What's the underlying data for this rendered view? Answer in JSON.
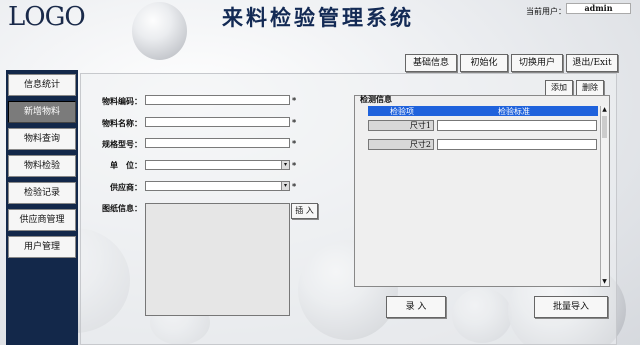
{
  "header": {
    "logo": "LOGO",
    "title": "来料检验管理系统",
    "user_label": "当前用户：",
    "user_value": "admin"
  },
  "top_buttons": [
    "基础信息",
    "初始化",
    "切换用户",
    "退出/Exit"
  ],
  "sidebar": {
    "items": [
      {
        "label": "信息统计",
        "active": false
      },
      {
        "label": "新增物料",
        "active": true
      },
      {
        "label": "物料查询",
        "active": false
      },
      {
        "label": "物料检验",
        "active": false
      },
      {
        "label": "检验记录",
        "active": false
      },
      {
        "label": "供应商管理",
        "active": false
      },
      {
        "label": "用户管理",
        "active": false
      }
    ]
  },
  "form": {
    "fields": [
      {
        "label": "物料编码：",
        "required": "*",
        "type": "text",
        "value": ""
      },
      {
        "label": "物料名称：",
        "required": "*",
        "type": "text",
        "value": ""
      },
      {
        "label": "规格型号：",
        "required": "*",
        "type": "text",
        "value": ""
      },
      {
        "label": "单　位：",
        "required": "*",
        "type": "select",
        "value": ""
      },
      {
        "label": "供应商：",
        "required": "*",
        "type": "select",
        "value": ""
      }
    ],
    "drawing_label": "图纸信息：",
    "insert_button": "插 入"
  },
  "inspection": {
    "title": "检测信息",
    "add_button": "添加",
    "delete_button": "删除",
    "columns": [
      "检验项",
      "检验标准"
    ],
    "rows": [
      {
        "name": "尺寸1",
        "value": ""
      },
      {
        "name": "尺寸2",
        "value": ""
      }
    ]
  },
  "actions": {
    "submit": "录 入",
    "bulk_import": "批量导入"
  },
  "colors": {
    "sidebar_bg": "#13284a",
    "header_blue": "#1f62dc",
    "title_color": "#132a55"
  }
}
